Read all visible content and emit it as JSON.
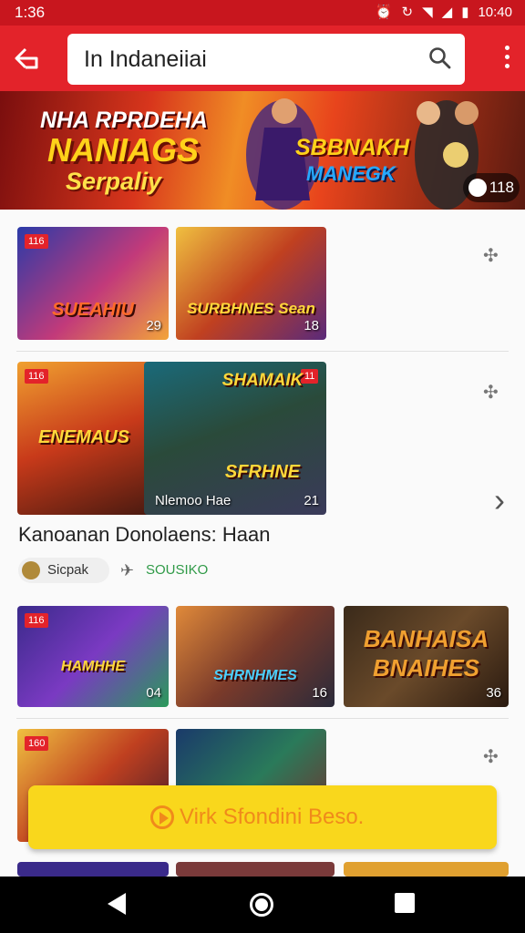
{
  "status_bar": {
    "time": "1:36",
    "right_time": "10:40"
  },
  "app_bar": {
    "search_query": "In Indaneiiai"
  },
  "banner": {
    "line1": "NHA RPRDEHA",
    "line2": "NANIAGS",
    "line3": "Serpaliy",
    "logo_a": "SBBNAKH",
    "logo_b": "MANEGK",
    "count": "118"
  },
  "rows": [
    {
      "items": [
        {
          "tag": "116",
          "title": "SUEAHIU",
          "count": "29"
        },
        {
          "title": "SURBHNES Sean",
          "count": "18"
        }
      ]
    },
    {
      "items": [
        {
          "tag": "116",
          "title": "ENEMAUS"
        },
        {
          "tag": "11",
          "title": "SHAMAIK",
          "title2": "SFRHNE",
          "caption": "Nlemoo Hae",
          "count": "21"
        }
      ],
      "section_title": "Kanoanan Donolaens: Haan",
      "chip_author": "Sicpak",
      "chip_status": "SOUSIKO"
    },
    {
      "items": [
        {
          "tag": "116",
          "title": "HAMHHE",
          "count": "04"
        },
        {
          "title": "SHRNHMES",
          "count": "16"
        },
        {
          "title": "BANHAISA BNAIHES",
          "count": "36"
        }
      ]
    },
    {
      "items": [
        {
          "tag": "160"
        },
        {}
      ]
    }
  ],
  "cta": {
    "label": "Virk Sfondini Beso."
  },
  "colors": {
    "primary": "#e3232a",
    "cta": "#f9d71c",
    "cta_text": "#f08a1b"
  }
}
